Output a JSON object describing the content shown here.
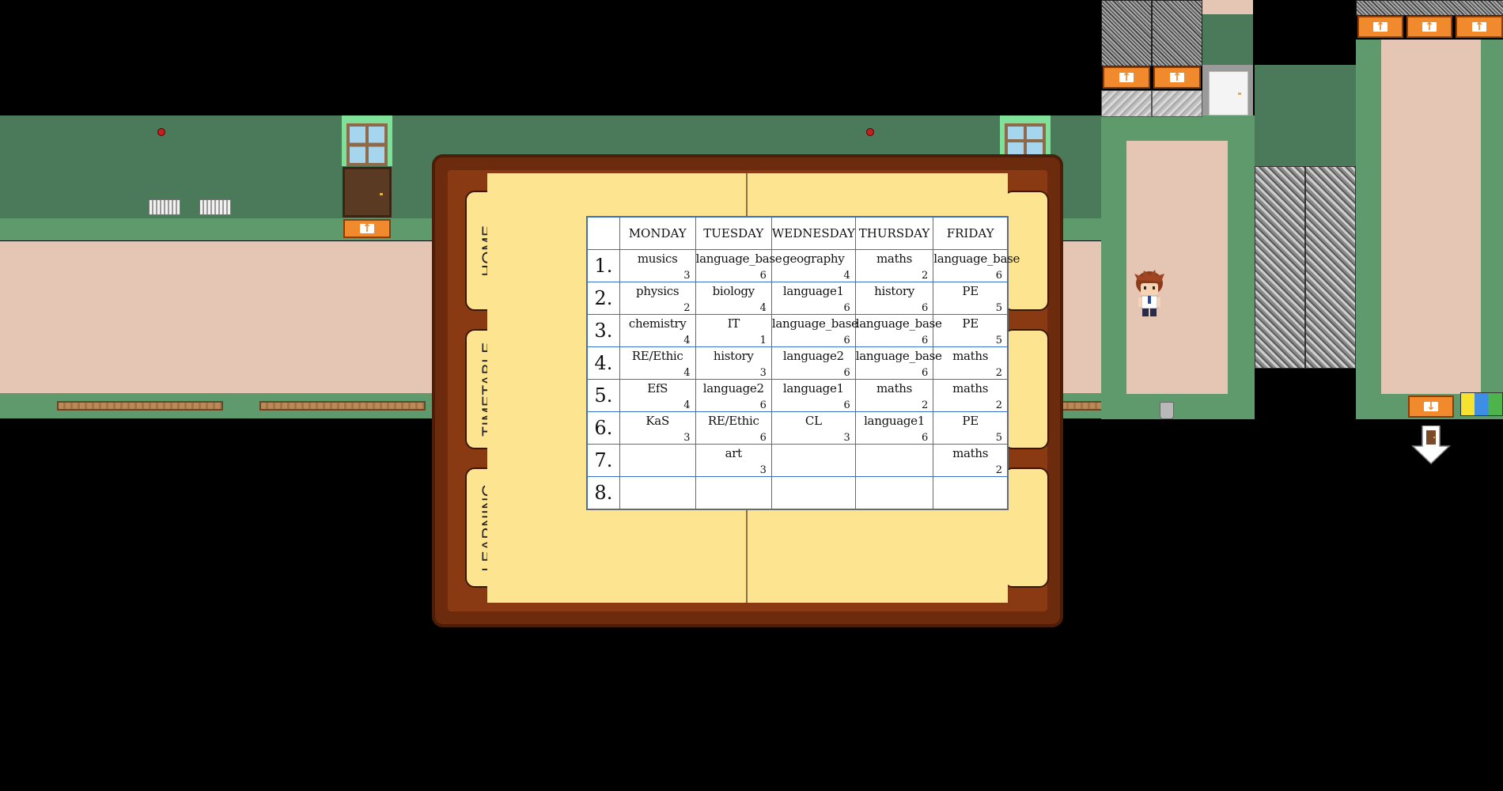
{
  "planner": {
    "tabs": [
      {
        "label": "HOME"
      },
      {
        "label": "TIMETABLE"
      },
      {
        "label": "LEARNING"
      }
    ],
    "timetable": {
      "days": [
        "MONDAY",
        "TUESDAY",
        "WEDNESDAY",
        "THURSDAY",
        "FRIDAY"
      ],
      "rows": [
        {
          "num": "1.",
          "cells": [
            {
              "subject": "musics",
              "count": "3"
            },
            {
              "subject": "language_base",
              "count": "6"
            },
            {
              "subject": "geography",
              "count": "4"
            },
            {
              "subject": "maths",
              "count": "2"
            },
            {
              "subject": "language_base",
              "count": "6"
            }
          ]
        },
        {
          "num": "2.",
          "cells": [
            {
              "subject": "physics",
              "count": "2"
            },
            {
              "subject": "biology",
              "count": "4"
            },
            {
              "subject": "language1",
              "count": "6"
            },
            {
              "subject": "history",
              "count": "6"
            },
            {
              "subject": "PE",
              "count": "5"
            }
          ]
        },
        {
          "num": "3.",
          "cells": [
            {
              "subject": "chemistry",
              "count": "4"
            },
            {
              "subject": "IT",
              "count": "1"
            },
            {
              "subject": "language_base",
              "count": "6"
            },
            {
              "subject": "language_base",
              "count": "6"
            },
            {
              "subject": "PE",
              "count": "5"
            }
          ]
        },
        {
          "num": "4.",
          "cells": [
            {
              "subject": "RE/Ethic",
              "count": "4"
            },
            {
              "subject": "history",
              "count": "3"
            },
            {
              "subject": "language2",
              "count": "6"
            },
            {
              "subject": "language_base",
              "count": "6"
            },
            {
              "subject": "maths",
              "count": "2"
            }
          ]
        },
        {
          "num": "5.",
          "cells": [
            {
              "subject": "EfS",
              "count": "4"
            },
            {
              "subject": "language2",
              "count": "6"
            },
            {
              "subject": "language1",
              "count": "6"
            },
            {
              "subject": "maths",
              "count": "2"
            },
            {
              "subject": "maths",
              "count": "2"
            }
          ]
        },
        {
          "num": "6.",
          "cells": [
            {
              "subject": "KaS",
              "count": "3"
            },
            {
              "subject": "RE/Ethic",
              "count": "6"
            },
            {
              "subject": "CL",
              "count": "3"
            },
            {
              "subject": "language1",
              "count": "6"
            },
            {
              "subject": "PE",
              "count": "5"
            }
          ]
        },
        {
          "num": "7.",
          "cells": [
            {
              "subject": "",
              "count": ""
            },
            {
              "subject": "art",
              "count": "3"
            },
            {
              "subject": "",
              "count": ""
            },
            {
              "subject": "",
              "count": ""
            },
            {
              "subject": "maths",
              "count": "2"
            }
          ]
        },
        {
          "num": "8.",
          "cells": [
            {
              "subject": "",
              "count": ""
            },
            {
              "subject": "",
              "count": ""
            },
            {
              "subject": "",
              "count": ""
            },
            {
              "subject": "",
              "count": ""
            },
            {
              "subject": "",
              "count": ""
            }
          ]
        }
      ]
    }
  },
  "world": {
    "icons": [
      "door-icon",
      "arrow-up-icon",
      "arrow-down-icon",
      "recycle-bin-icon",
      "player-character-icon",
      "radiator-icon",
      "fire-alarm-icon"
    ]
  },
  "colors": {
    "planner_frame": "#6b2b0c",
    "page": "#fde491",
    "grid_line": "#3a6fcf",
    "floor_pink": "#e5c5b4",
    "floor_green": "#5f9a6d",
    "wall_green": "#4a7a5a",
    "sign_orange": "#f08a2c"
  }
}
